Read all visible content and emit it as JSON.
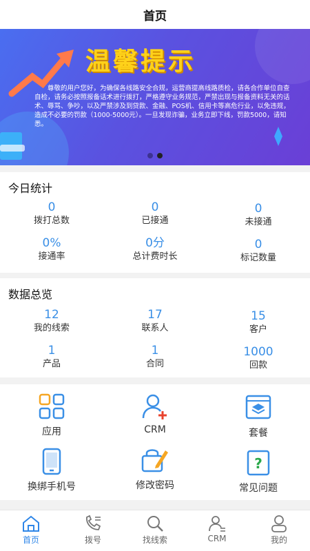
{
  "header": {
    "title": "首页"
  },
  "banner": {
    "title": "温馨提示",
    "text": "尊敬的用户您好，为确保各线路安全合规，运营商提高线路质检，请各合作单位自查自检，请务必按照报备话术进行拨打，严格遵守业务规范，严禁出现与报备资料无关的话术、辱骂、争吵，以及严禁涉及到贷款、金融、POS机、信用卡等高危行业，以免违规，造成不必要的罚款（1000-5000元）。一旦发现诈骗，业务立即下线，罚款5000，请知悉。"
  },
  "today": {
    "title": "今日统计",
    "stats": [
      {
        "value": "0",
        "label": "拨打总数"
      },
      {
        "value": "0",
        "label": "已接通"
      },
      {
        "value": "0",
        "label": "未接通"
      },
      {
        "value": "0%",
        "label": "接通率"
      },
      {
        "value": "0分",
        "label": "总计费时长"
      },
      {
        "value": "0",
        "label": "标记数量"
      }
    ]
  },
  "overview": {
    "title": "数据总览",
    "stats": [
      {
        "value": "12",
        "label": "我的线索"
      },
      {
        "value": "17",
        "label": "联系人"
      },
      {
        "value": "15",
        "label": "客户"
      },
      {
        "value": "1",
        "label": "产品"
      },
      {
        "value": "1",
        "label": "合同"
      },
      {
        "value": "1000",
        "label": "回款"
      }
    ]
  },
  "grid": [
    {
      "label": "应用",
      "icon": "apps-icon"
    },
    {
      "label": "CRM",
      "icon": "add-user-icon"
    },
    {
      "label": "套餐",
      "icon": "package-icon"
    },
    {
      "label": "换绑手机号",
      "icon": "phone-icon"
    },
    {
      "label": "修改密码",
      "icon": "edit-lock-icon"
    },
    {
      "label": "常见问题",
      "icon": "help-icon"
    }
  ],
  "tabs": [
    {
      "label": "首页",
      "icon": "home-icon",
      "active": true
    },
    {
      "label": "拨号",
      "icon": "dial-icon"
    },
    {
      "label": "找线索",
      "icon": "search-icon"
    },
    {
      "label": "CRM",
      "icon": "contacts-icon"
    },
    {
      "label": "我的",
      "icon": "profile-icon"
    }
  ],
  "colors": {
    "accent": "#2e86e8",
    "value": "#3a8fe6",
    "banner_title": "#ffd21a"
  }
}
